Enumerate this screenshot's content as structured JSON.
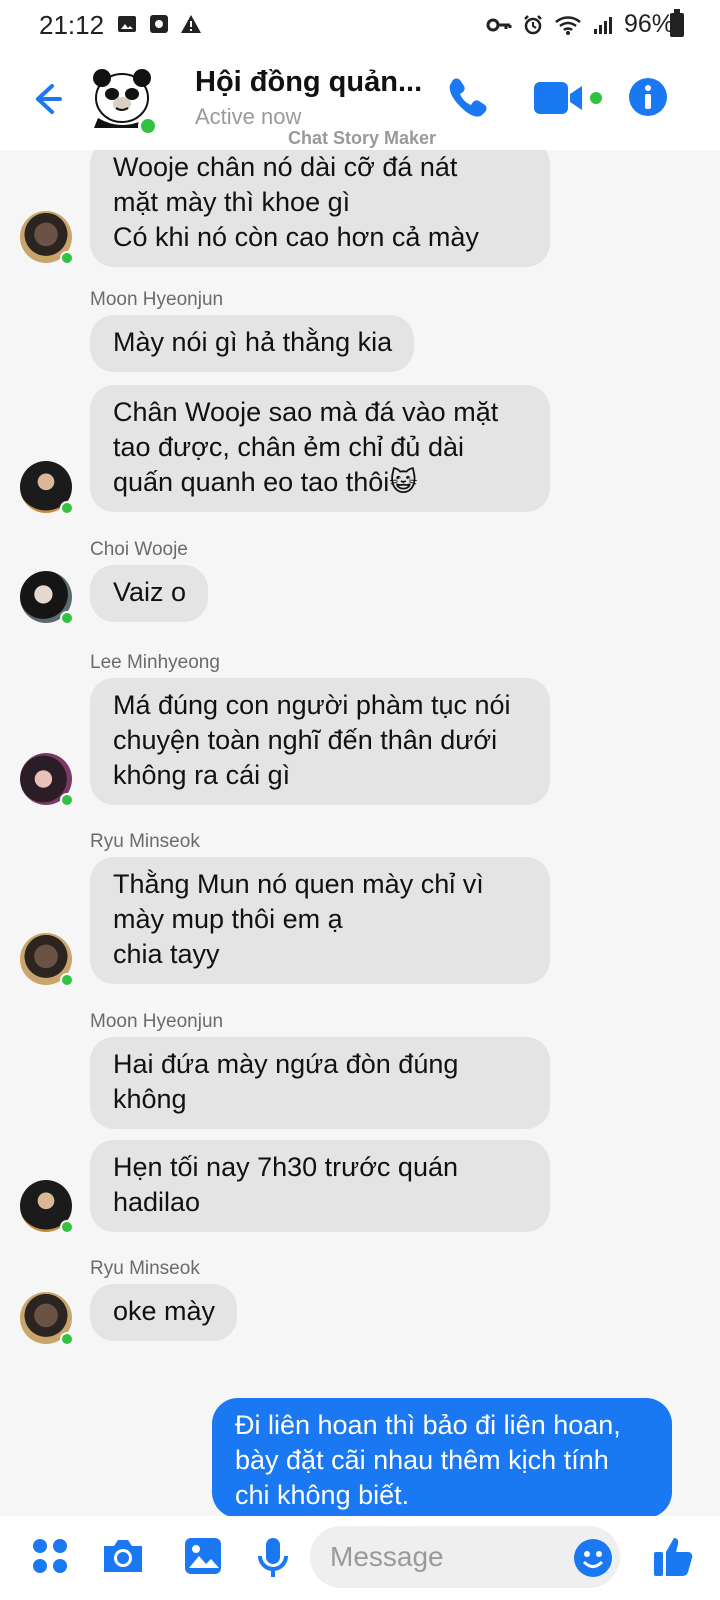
{
  "status_bar": {
    "time": "21:12",
    "battery": "96%"
  },
  "header": {
    "title": "Hội đồng quản...",
    "status": "Active now",
    "watermark": "Chat Story Maker"
  },
  "colors": {
    "accent": "#1a78f3",
    "online": "#31c242",
    "bubble_other": "#e4e4e4",
    "bubble_mine": "#1a78f3"
  },
  "messages": [
    {
      "sender": "",
      "text": "Wooje chân nó dài cỡ đá nát\nmặt mày thì khoe gì\nCó khi nó còn cao hơn cả mày"
    },
    {
      "sender": "Moon Hyeonjun",
      "text": "Mày nói gì hả thằng kia"
    },
    {
      "sender": "",
      "text": "Chân Wooje sao mà đá vào mặt tao được, chân ẻm chỉ đủ dài quấn quanh eo tao thôi😺"
    },
    {
      "sender": "Choi Wooje",
      "text": "Vaiz o"
    },
    {
      "sender": "Lee Minhyeong",
      "text": "Má đúng con người phàm tục nói chuyện toàn nghĩ đến thân dưới không ra cái gì"
    },
    {
      "sender": "Ryu Minseok",
      "text": "Thằng Mun nó quen mày chỉ vì\nmày mup thôi em ạ\nchia tayy"
    },
    {
      "sender": "Moon Hyeonjun",
      "text": "Hai đứa mày ngứa đòn đúng không"
    },
    {
      "sender": "",
      "text": "Hẹn tối nay 7h30 trước quán hadilao"
    },
    {
      "sender": "Ryu Minseok",
      "text": "oke mày"
    },
    {
      "sender": "me",
      "text": "Đi liên hoan thì bảo đi liên hoan, bày đặt cãi nhau thêm kịch tính chi không biết."
    }
  ],
  "composer": {
    "placeholder": "Message"
  }
}
